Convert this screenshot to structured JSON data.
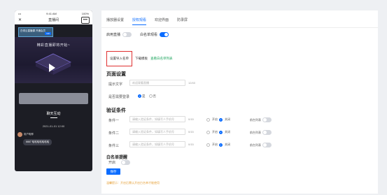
{
  "phone": {
    "status_left": "••• ",
    "status_time": "9:41 AM",
    "status_right": "100%",
    "title": "直播间",
    "close_glyph": "✕",
    "more_glyph": "•••",
    "banner_text": "白领云直播课 开通会员",
    "banner_button": "VIP",
    "video_caption": "精彩直播即将开始~",
    "chat_tab": "聊天互动",
    "chat_time": "2021-01-01 12:00",
    "chat_user": "用户昵称",
    "chat_message": "6667 哈哈哈哈哈哈哈",
    "heart_glyph": "♥"
  },
  "tabs": [
    "播放器设置",
    "授权观看",
    "欢迎界面",
    "防录屏"
  ],
  "toggles": {
    "enable_label": "启用直播",
    "whitelist_label": "白名单观看"
  },
  "mode": {
    "option1": "设置导入名单",
    "option2": "下载模板",
    "link": "查看白名单列表"
  },
  "page_settings": {
    "heading": "页面设置",
    "prompt_label": "提示文字",
    "prompt_placeholder": "欢迎观看直播",
    "prompt_count": "12/40",
    "login_label": "是否需要登录",
    "yes": "是",
    "no": "否"
  },
  "verify": {
    "heading": "验证条件",
    "rows": [
      {
        "label": "条件一",
        "placeholder": "请输入验证条件，如填写人手机号",
        "count": "0/15",
        "open": "开启",
        "close": "关闭",
        "show_label": "前台列表"
      },
      {
        "label": "条件二",
        "placeholder": "请输入验证条件，如填写人手机号",
        "count": "0/15",
        "open": "开启",
        "close": "关闭",
        "show_label": "前台列表"
      },
      {
        "label": "条件三",
        "placeholder": "请输入验证条件，如填写人手机号",
        "count": "0/15",
        "open": "开启",
        "close": "关闭",
        "show_label": "前台列表"
      }
    ]
  },
  "whitelist_remind": {
    "heading": "白名单提醒",
    "enable_label": "开启"
  },
  "save_label": "保存",
  "hint": "温馨提示：开启后需认开启白名单才能使用"
}
